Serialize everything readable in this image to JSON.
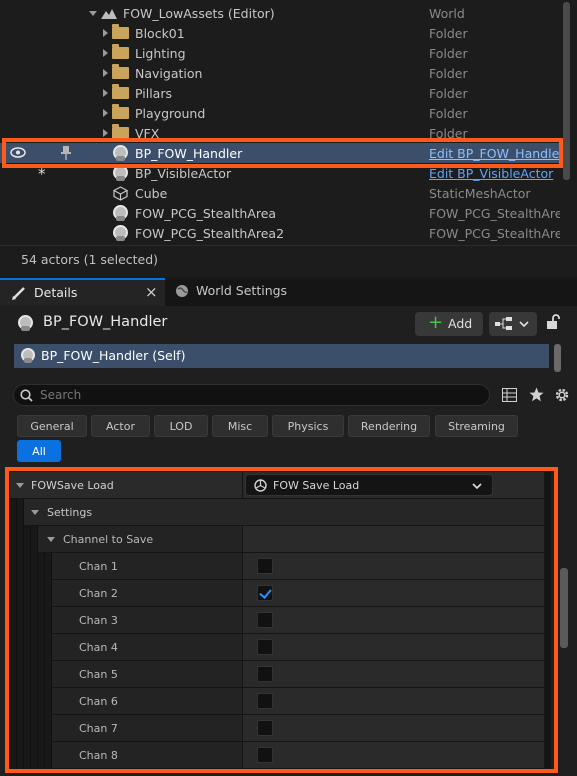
{
  "outliner": {
    "root": {
      "label": "FOW_LowAssets (Editor)",
      "type": "World"
    },
    "folders": [
      {
        "label": "Block01",
        "type": "Folder"
      },
      {
        "label": "Lighting",
        "type": "Folder"
      },
      {
        "label": "Navigation",
        "type": "Folder"
      },
      {
        "label": "Pillars",
        "type": "Folder"
      },
      {
        "label": "Playground",
        "type": "Folder"
      },
      {
        "label": "VFX",
        "type": "Folder"
      }
    ],
    "actors": [
      {
        "label": "BP_FOW_Handler",
        "type": "Edit BP_FOW_Handler"
      },
      {
        "label": "BP_VisibleActor",
        "type": "Edit BP_VisibleActor",
        "modified_mark": "*"
      },
      {
        "label": "Cube",
        "type": "StaticMeshActor"
      },
      {
        "label": "FOW_PCG_StealthArea",
        "type": "FOW_PCG_StealthArea"
      },
      {
        "label": "FOW_PCG_StealthArea2",
        "type": "FOW_PCG_StealthArea"
      }
    ],
    "status": "54 actors (1 selected)"
  },
  "tabs": {
    "details": "Details",
    "close": "×",
    "world_settings": "World Settings"
  },
  "details": {
    "object_name": "BP_FOW_Handler",
    "add_label": "Add",
    "component_self": "BP_FOW_Handler (Self)",
    "search_placeholder": "Search",
    "filters": [
      "General",
      "Actor",
      "LOD",
      "Misc",
      "Physics",
      "Rendering",
      "Streaming"
    ],
    "filter_all": "All"
  },
  "properties": {
    "category": "FOWSave Load",
    "category_value": "FOW Save Load",
    "settings": "Settings",
    "channel_group": "Channel to Save",
    "channels": [
      {
        "label": "Chan 1",
        "checked": false
      },
      {
        "label": "Chan 2",
        "checked": true
      },
      {
        "label": "Chan 3",
        "checked": false
      },
      {
        "label": "Chan 4",
        "checked": false
      },
      {
        "label": "Chan 5",
        "checked": false
      },
      {
        "label": "Chan 6",
        "checked": false
      },
      {
        "label": "Chan 7",
        "checked": false
      },
      {
        "label": "Chan 8",
        "checked": false
      }
    ]
  },
  "colors": {
    "highlight": "#ff5a1a",
    "selected_row": "#3b4f6b",
    "link": "#5fa4ff",
    "accent_blue": "#0b70e0"
  }
}
